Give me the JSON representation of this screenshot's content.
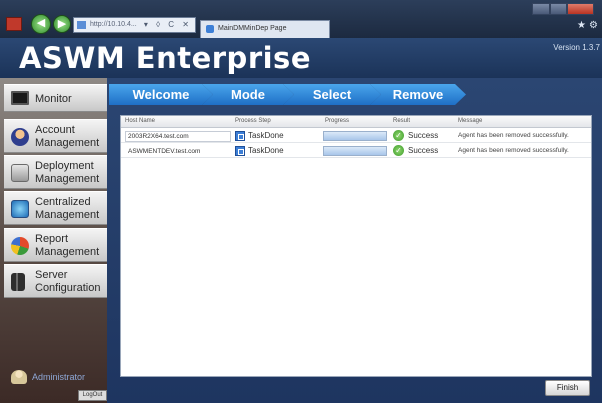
{
  "browser": {
    "address": "http://10.10.4...",
    "tab_title": "MainDMMinDep Page"
  },
  "app": {
    "title": "ASWM Enterprise",
    "version": "Version 1.3.7"
  },
  "sidebar": {
    "items": [
      {
        "label": "Monitor",
        "icon": "monitor-icon"
      },
      {
        "label": "Account\nManagement",
        "icon": "account-icon"
      },
      {
        "label": "Deployment\nManagement",
        "icon": "deployment-icon"
      },
      {
        "label": "Centralized\nManagement",
        "icon": "centralized-icon"
      },
      {
        "label": "Report\nManagement",
        "icon": "report-icon"
      },
      {
        "label": "Server\nConfiguration",
        "icon": "server-icon"
      }
    ],
    "user": "Administrator",
    "logout": "LogOut"
  },
  "wizard": {
    "steps": [
      "Welcome",
      "Mode",
      "Select",
      "Remove"
    ]
  },
  "table": {
    "columns": [
      "Host Name",
      "Process Step",
      "Progress",
      "Result",
      "Message"
    ],
    "rows": [
      {
        "host": "2003R2X64.test.com",
        "step": "TaskDone",
        "progress": 1.0,
        "result": "Success",
        "message": "Agent has been removed successfully."
      },
      {
        "host": "ASWMENTDEV.test.com",
        "step": "TaskDone",
        "progress": 1.0,
        "result": "Success",
        "message": "Agent has been removed successfully."
      }
    ]
  },
  "footer": {
    "finish_label": "Finish"
  },
  "colors": {
    "header_bg": "#1b3358",
    "step_blue": "#1f6fc6",
    "success_green": "#3c9a2a"
  }
}
